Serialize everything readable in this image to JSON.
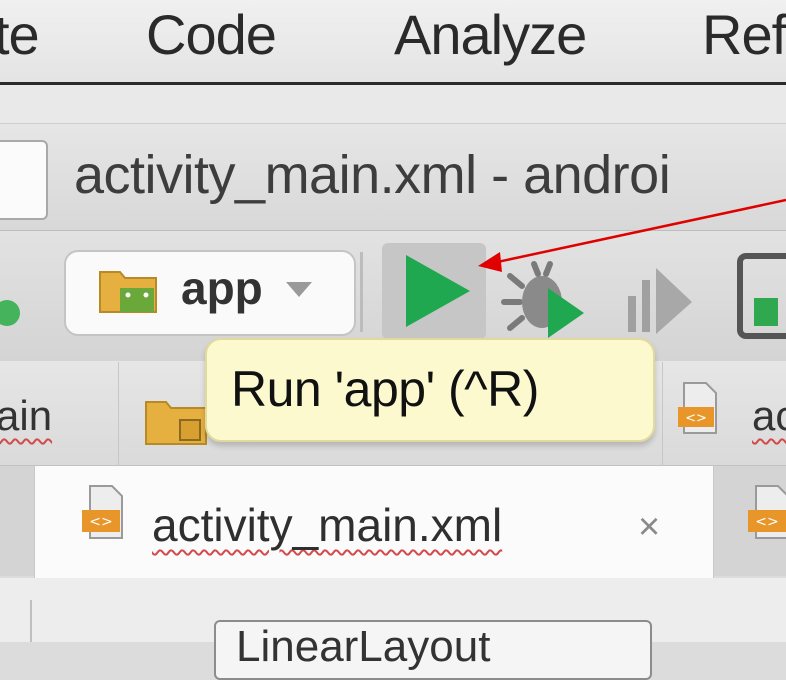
{
  "menubar": {
    "items": [
      "te",
      "Code",
      "Analyze",
      "Ref"
    ]
  },
  "window": {
    "title": "activity_main.xml - androi"
  },
  "toolbar": {
    "run_config": "app",
    "icons": [
      "folder-android-icon",
      "dropdown-caret-icon",
      "run-icon",
      "debug-icon",
      "profile-icon",
      "device-icon"
    ],
    "run_color": "#1fa84f"
  },
  "tooltip": {
    "text": "Run 'app' (^R)"
  },
  "navbar": {
    "crumb_left": "ain",
    "crumb_right": "ac"
  },
  "tabs": [
    {
      "label": "activity_main.xml",
      "close": "×",
      "active": true
    }
  ],
  "editor": {
    "palette_item": "LinearLayout"
  },
  "annotation": {
    "arrow_color": "#e00000"
  }
}
